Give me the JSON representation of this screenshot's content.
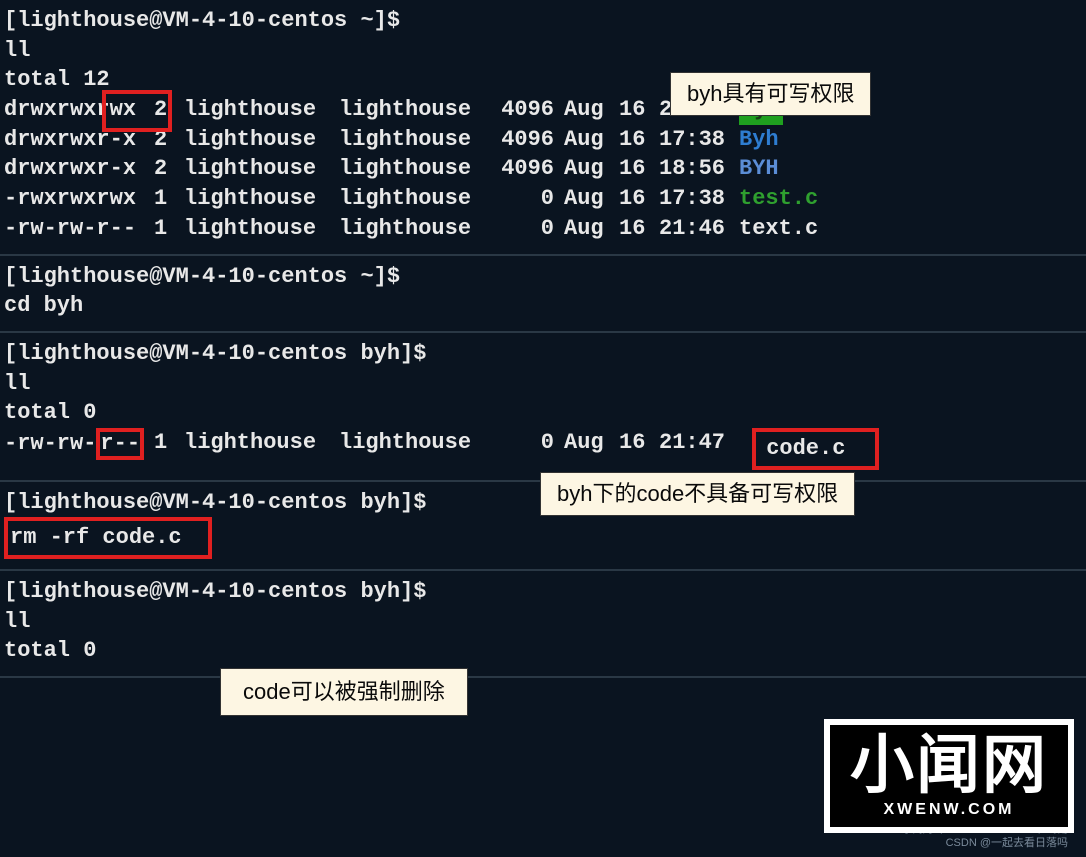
{
  "prompts": {
    "home": "[lighthouse@VM-4-10-centos ~]$",
    "byh": "[lighthouse@VM-4-10-centos byh]$"
  },
  "block1": {
    "cmd": "ll",
    "total": "total 12",
    "rows": [
      {
        "perm": "drwxrwxrwx",
        "n": "2",
        "u": "lighthouse",
        "g": "lighthouse",
        "s": "4096",
        "mo": "Aug",
        "d": "16",
        "t": "21:47",
        "f": "byh",
        "cls": "hl-green-bg"
      },
      {
        "perm": "drwxrwxr-x",
        "n": "2",
        "u": "lighthouse",
        "g": "lighthouse",
        "s": "4096",
        "mo": "Aug",
        "d": "16",
        "t": "17:38",
        "f": "Byh",
        "cls": "hl-bright-blue"
      },
      {
        "perm": "drwxrwxr-x",
        "n": "2",
        "u": "lighthouse",
        "g": "lighthouse",
        "s": "4096",
        "mo": "Aug",
        "d": "16",
        "t": "18:56",
        "f": "BYH",
        "cls": "hl-blue"
      },
      {
        "perm": "-rwxrwxrwx",
        "n": "1",
        "u": "lighthouse",
        "g": "lighthouse",
        "s": "0",
        "mo": "Aug",
        "d": "16",
        "t": "17:38",
        "f": "test.c",
        "cls": "hl-green"
      },
      {
        "perm": "-rw-rw-r--",
        "n": "1",
        "u": "lighthouse",
        "g": "lighthouse",
        "s": "0",
        "mo": "Aug",
        "d": "16",
        "t": "21:46",
        "f": "text.c",
        "cls": ""
      }
    ]
  },
  "block2": {
    "cmd": "cd byh"
  },
  "block3": {
    "cmd": "ll",
    "total": "total 0",
    "row": {
      "perm_a": "-rw-rw-",
      "perm_b": "r--",
      "n": "1",
      "u": "lighthouse",
      "g": "lighthouse",
      "s": "0",
      "mo": "Aug",
      "d": "16",
      "t": "21:47",
      "f": "code.c"
    }
  },
  "block4": {
    "cmd": "rm -rf code.c"
  },
  "block5": {
    "cmd": "ll",
    "total": "total 0"
  },
  "annotations": {
    "a1": "byh具有可写权限",
    "a2": "byh下的code不具备可写权限",
    "a3": "code可以被强制删除"
  },
  "watermark": {
    "big": "小闻网",
    "small": "XWENW.COM",
    "foot1": "小闻网（WWW.XWENW.COM）专用",
    "foot2": "CSDN @一起去看日落吗"
  }
}
